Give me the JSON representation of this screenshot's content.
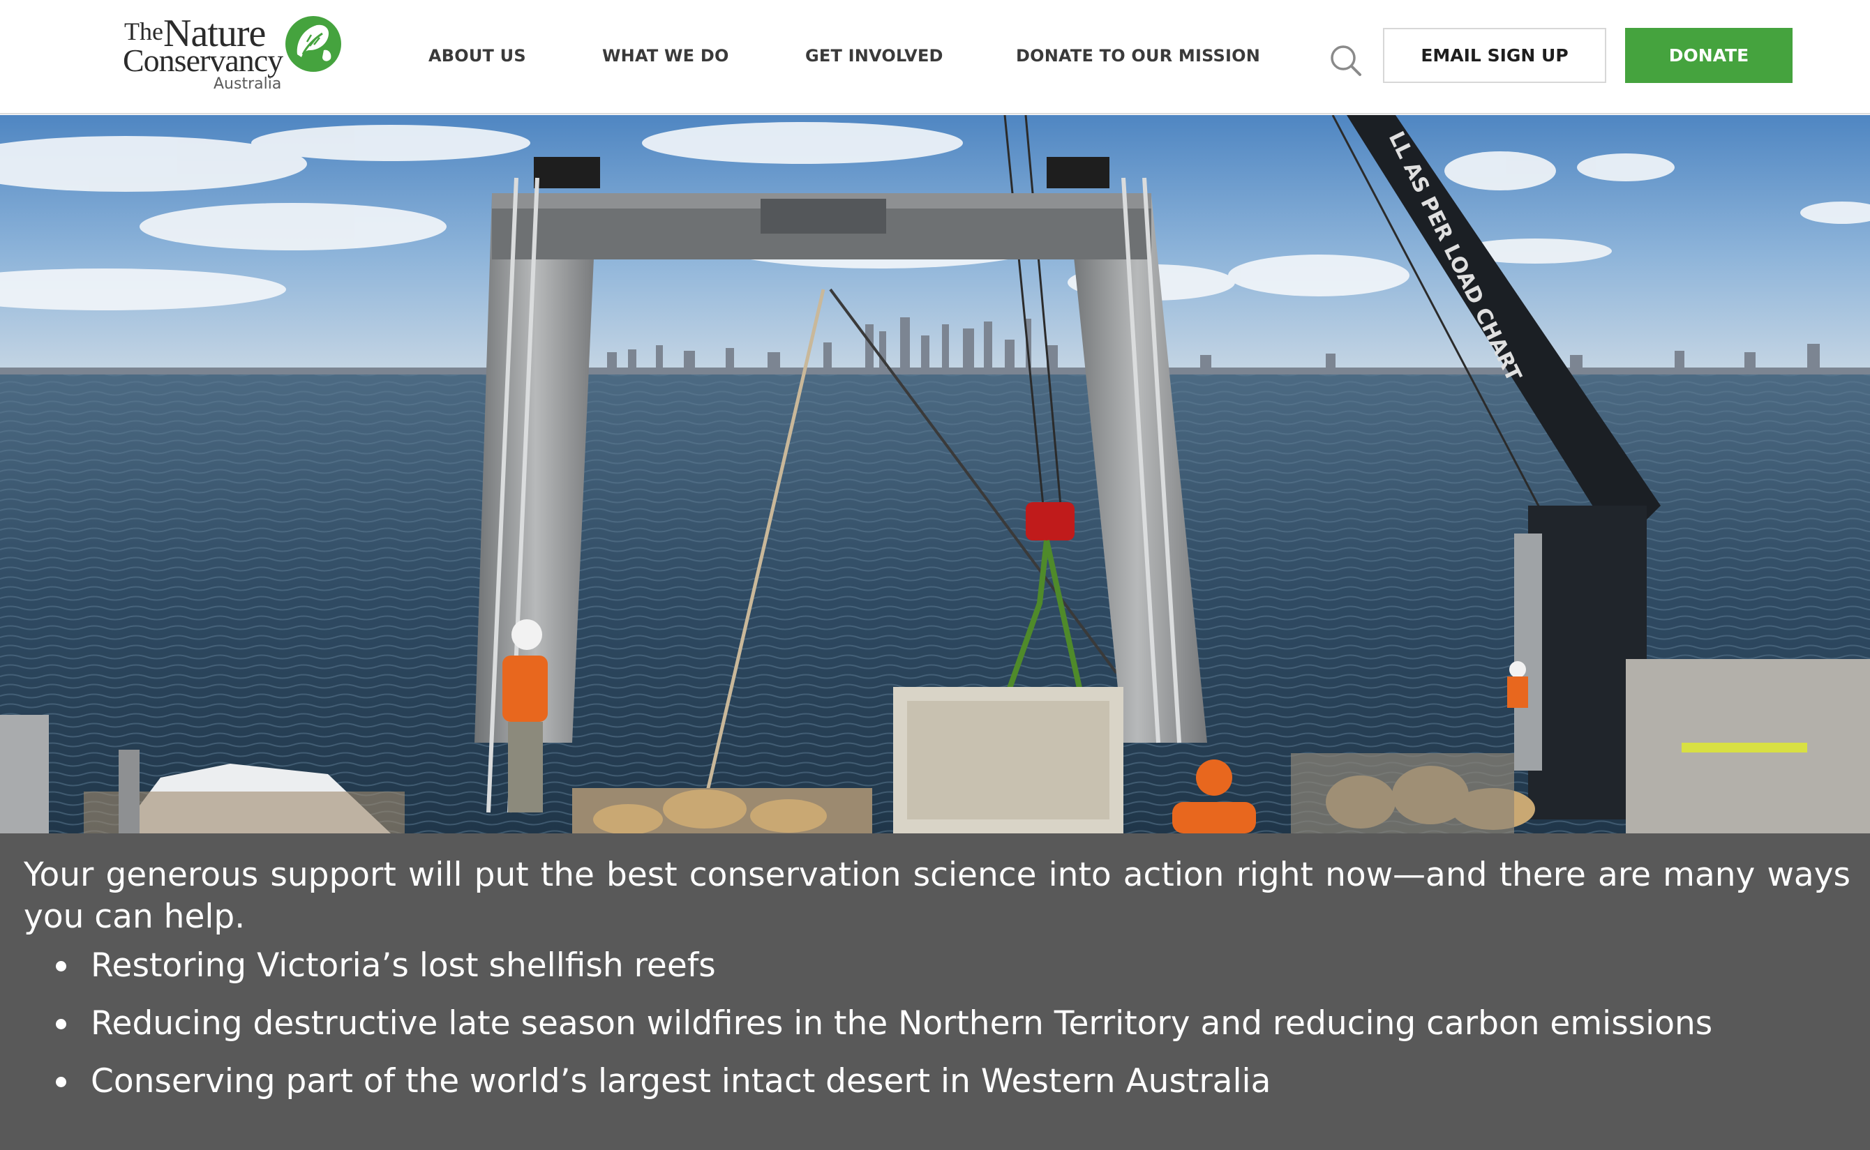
{
  "brand": {
    "logo_line1_small": "The",
    "logo_line1": "Nature",
    "logo_line2": "Conservancy",
    "logo_country": "Australia",
    "logo_color": "#45a33e"
  },
  "nav": {
    "items": [
      {
        "label": "ABOUT US"
      },
      {
        "label": "WHAT WE DO"
      },
      {
        "label": "GET INVOLVED"
      },
      {
        "label": "DONATE TO OUR MISSION"
      }
    ]
  },
  "header_actions": {
    "search_icon": "search-icon",
    "email_label": "EMAIL SIGN UP",
    "donate_label": "DONATE",
    "donate_color": "#45a33e"
  },
  "hero": {
    "image": "reef-restoration-boat-photo",
    "crane_text": "LL AS PER LOAD CHART"
  },
  "panel": {
    "background": "#595959",
    "lead": "Your generous support will put the best conservation science into action right now—and there are many ways you can help.",
    "bullets": [
      {
        "text": "Restoring Victoria’s lost shellfish reefs"
      },
      {
        "text": "Reducing destructive late season wildfires in the Northern Territory and reducing carbon emissions"
      },
      {
        "text": "Conserving part of the world’s largest intact desert in Western Australia"
      }
    ]
  }
}
